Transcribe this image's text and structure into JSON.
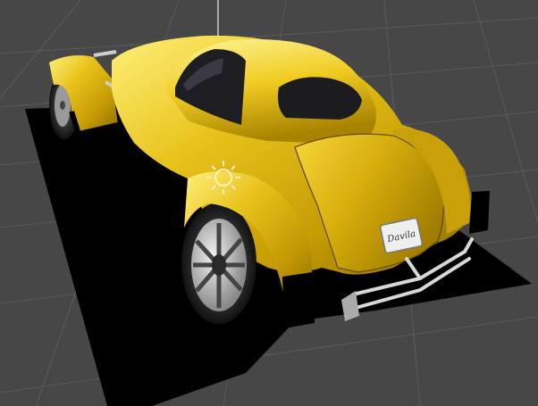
{
  "viewport": {
    "background": "#474747",
    "grid_color": "#5c5c5c",
    "axis_color": "#bfbfbf"
  },
  "scene": {
    "model": "yellow-coupe",
    "body_color": "#d9b20a",
    "body_highlight": "#fff07a",
    "body_shadow": "#8a6a00",
    "shadow_color": "#000000",
    "plate_text": "Davila",
    "light_gizmo_icon": "sun-icon"
  }
}
